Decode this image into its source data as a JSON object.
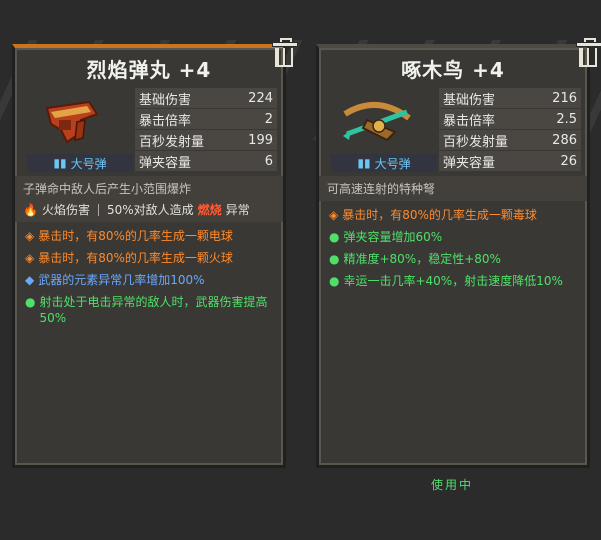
{
  "left": {
    "title": "烈焰弹丸 +4",
    "ammo": "大号弹",
    "stats": [
      {
        "label": "基础伤害",
        "value": "224"
      },
      {
        "label": "暴击倍率",
        "value": "2"
      },
      {
        "label": "百秒发射量",
        "value": "199"
      },
      {
        "label": "弹夹容量",
        "value": "6"
      }
    ],
    "desc": "子弹命中敌人后产生小范围爆炸",
    "tag_type": "火焰伤害",
    "tag_effect_prefix": "50%对敌人造成",
    "tag_effect_burn": "燃烧",
    "tag_effect_suffix": "异常",
    "effects": [
      {
        "bullet": "◈",
        "text": "暴击时，有80%的几率生成一颗电球",
        "color": "orange"
      },
      {
        "bullet": "◈",
        "text": "暴击时，有80%的几率生成一颗火球",
        "color": "orange"
      },
      {
        "bullet": "◆",
        "text": "武器的元素异常几率增加100%",
        "color": "blue"
      },
      {
        "bullet": "●",
        "text": "射击处于电击异常的敌人时，武器伤害提高50%",
        "color": "green"
      }
    ]
  },
  "right": {
    "title": "啄木鸟 +4",
    "ammo": "大号弹",
    "stats": [
      {
        "label": "基础伤害",
        "value": "216"
      },
      {
        "label": "暴击倍率",
        "value": "2.5"
      },
      {
        "label": "百秒发射量",
        "value": "286"
      },
      {
        "label": "弹夹容量",
        "value": "26"
      }
    ],
    "desc": "可高速连射的特种弩",
    "effects": [
      {
        "bullet": "◈",
        "text": "暴击时，有80%的几率生成一颗毒球",
        "color": "orange"
      },
      {
        "bullet": "●",
        "text": "弹夹容量增加60%",
        "color": "green"
      },
      {
        "bullet": "●",
        "text": "精准度+80%，稳定性+80%",
        "color": "green"
      },
      {
        "bullet": "●",
        "text": "幸运一击几率+40%，射击速度降低10%",
        "color": "green"
      }
    ]
  },
  "status": "使用中",
  "colors": {
    "orange": "#ff8a2a",
    "blue": "#6aa8ff",
    "green": "#4fe06a",
    "accent": "#c9741e"
  }
}
